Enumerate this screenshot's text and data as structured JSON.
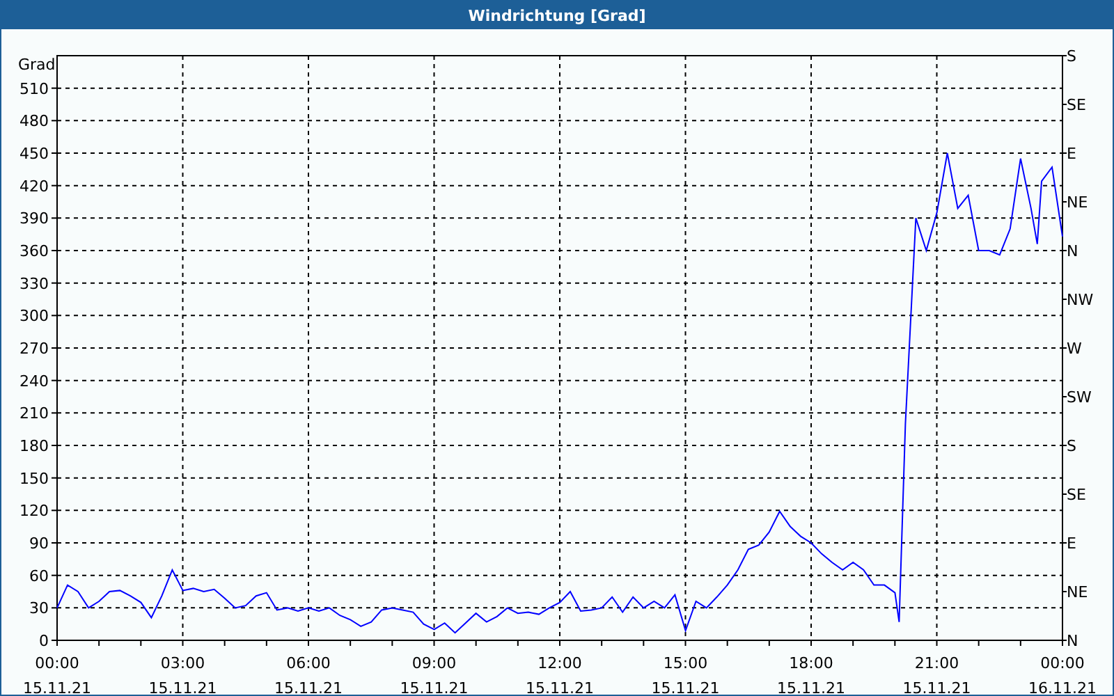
{
  "window": {
    "title": "Windrichtung [Grad]"
  },
  "chart": {
    "chart_data": {
      "type": "line",
      "grid": true,
      "ylabel": "Grad",
      "xlim": [
        0,
        24
      ],
      "ylim": [
        0,
        540
      ],
      "x": [
        0,
        0.25,
        0.5,
        0.75,
        1,
        1.25,
        1.5,
        1.75,
        2,
        2.25,
        2.5,
        2.75,
        3,
        3.25,
        3.5,
        3.75,
        4,
        4.25,
        4.5,
        4.75,
        5,
        5.25,
        5.5,
        5.75,
        6,
        6.25,
        6.5,
        6.75,
        7,
        7.25,
        7.5,
        7.75,
        8,
        8.25,
        8.5,
        8.75,
        9,
        9.25,
        9.5,
        9.75,
        10,
        10.25,
        10.5,
        10.75,
        11,
        11.25,
        11.5,
        11.75,
        12,
        12.25,
        12.5,
        12.75,
        13,
        13.25,
        13.5,
        13.75,
        14,
        14.25,
        14.5,
        14.75,
        15,
        15.25,
        15.5,
        15.75,
        16,
        16.25,
        16.5,
        16.75,
        17,
        17.25,
        17.5,
        17.75,
        18,
        18.25,
        18.5,
        18.75,
        19,
        19.25,
        19.5,
        19.75,
        20,
        20.1,
        20.25,
        20.5,
        20.75,
        21,
        21.25,
        21.5,
        21.75,
        22,
        22.25,
        22.5,
        22.75,
        23,
        23.25,
        23.4,
        23.5,
        23.75,
        24
      ],
      "series": [
        {
          "color": "#0000ff",
          "values": [
            30,
            51,
            45,
            30,
            36,
            45,
            46,
            41,
            35,
            21,
            41,
            65,
            46,
            48,
            45,
            47,
            39,
            30,
            32,
            41,
            44,
            28,
            30,
            27,
            30,
            27,
            30,
            23,
            19,
            13,
            17,
            28,
            30,
            28,
            26,
            15,
            10,
            16,
            7,
            16,
            25,
            17,
            22,
            30,
            25,
            26,
            24,
            30,
            35,
            45,
            27,
            28,
            30,
            40,
            26,
            40,
            30,
            36,
            30,
            42,
            9,
            36,
            30,
            40,
            51,
            65,
            84,
            88,
            100,
            119,
            105,
            96,
            90,
            80,
            72,
            65,
            72,
            65,
            51,
            51,
            44,
            17,
            200,
            390,
            360,
            395,
            450,
            399,
            411,
            360,
            360,
            356,
            380,
            445,
            399,
            366,
            424,
            437,
            373
          ]
        }
      ],
      "yticks": [
        0,
        30,
        60,
        90,
        120,
        150,
        180,
        210,
        240,
        270,
        300,
        330,
        360,
        390,
        420,
        450,
        480,
        510
      ],
      "xticks": [
        {
          "value": 0,
          "label": "00:00"
        },
        {
          "value": 3,
          "label": "03:00"
        },
        {
          "value": 6,
          "label": "06:00"
        },
        {
          "value": 9,
          "label": "09:00"
        },
        {
          "value": 12,
          "label": "12:00"
        },
        {
          "value": 15,
          "label": "15:00"
        },
        {
          "value": 18,
          "label": "18:00"
        },
        {
          "value": 21,
          "label": "21:00"
        },
        {
          "value": 24,
          "label": "00:00"
        }
      ]
    },
    "x_dates": [
      "15.11.21",
      "15.11.21",
      "15.11.21",
      "15.11.21",
      "15.11.21",
      "15.11.21",
      "15.11.21",
      "15.11.21",
      "16.11.21"
    ],
    "right_axis_labels": [
      "S",
      "SE",
      "E",
      "NE",
      "N",
      "NW",
      "W",
      "SW",
      "S",
      "SE",
      "E",
      "NE",
      "N"
    ]
  }
}
